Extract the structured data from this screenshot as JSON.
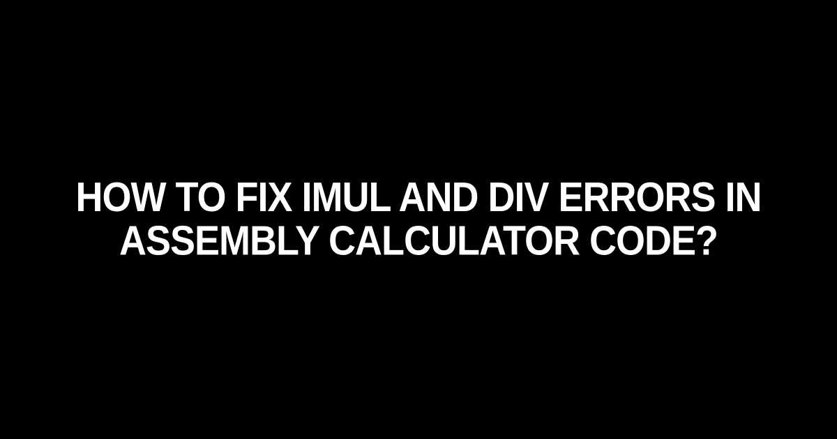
{
  "title": "HOW TO FIX IMUL AND DIV ERRORS IN ASSEMBLY CALCULATOR CODE?"
}
